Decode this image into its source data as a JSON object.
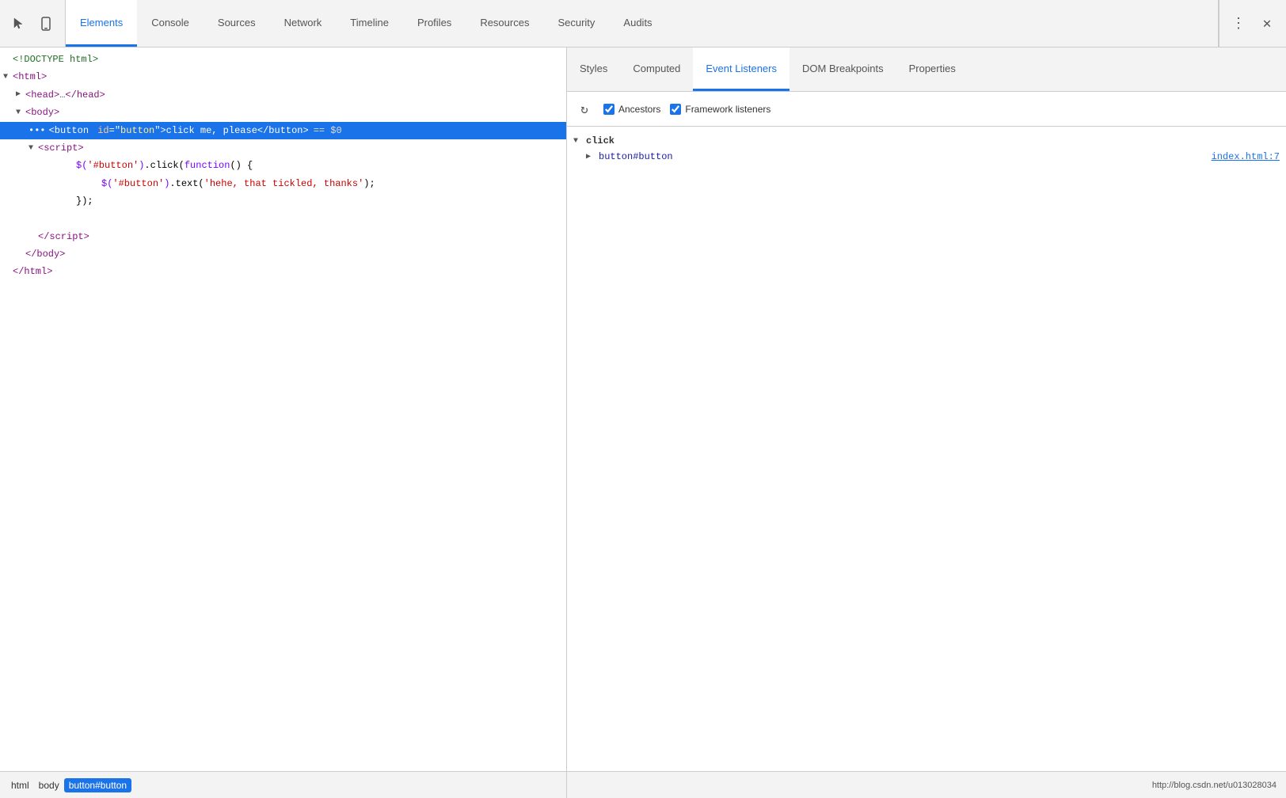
{
  "toolbar": {
    "tabs": [
      {
        "label": "Elements",
        "active": true
      },
      {
        "label": "Console",
        "active": false
      },
      {
        "label": "Sources",
        "active": false
      },
      {
        "label": "Network",
        "active": false
      },
      {
        "label": "Timeline",
        "active": false
      },
      {
        "label": "Profiles",
        "active": false
      },
      {
        "label": "Resources",
        "active": false
      },
      {
        "label": "Security",
        "active": false
      },
      {
        "label": "Audits",
        "active": false
      }
    ]
  },
  "right_tabs": [
    {
      "label": "Styles",
      "active": false
    },
    {
      "label": "Computed",
      "active": false
    },
    {
      "label": "Event Listeners",
      "active": true
    },
    {
      "label": "DOM Breakpoints",
      "active": false
    },
    {
      "label": "Properties",
      "active": false
    }
  ],
  "right_toolbar": {
    "ancestors_label": "Ancestors",
    "framework_label": "Framework listeners"
  },
  "event_listeners": {
    "click_label": "click",
    "node_label": "button#button",
    "file_label": "index.html:7"
  },
  "breadcrumbs": [
    {
      "label": "html"
    },
    {
      "label": "body"
    },
    {
      "label": "button#button",
      "active": true
    }
  ],
  "bottom_url": "http://blog.csdn.net/u013028034"
}
